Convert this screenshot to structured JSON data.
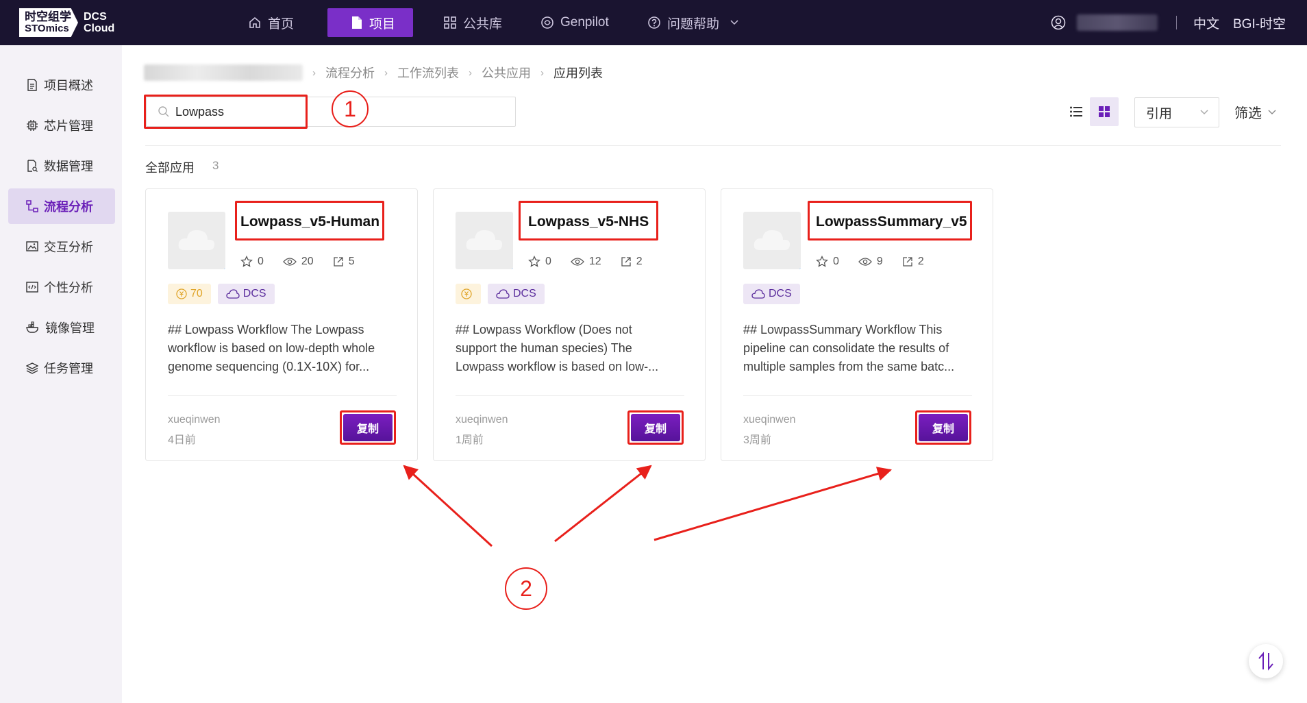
{
  "logo": {
    "line1": "时空组学",
    "line2": "STOmics",
    "product1": "DCS",
    "product2": "Cloud"
  },
  "nav": [
    {
      "label": "首页",
      "icon": "home-icon"
    },
    {
      "label": "项目",
      "icon": "file-icon"
    },
    {
      "label": "公共库",
      "icon": "grid-icon"
    },
    {
      "label": "Genpilot",
      "icon": "genpilot-icon"
    },
    {
      "label": "问题帮助",
      "icon": "help-icon"
    }
  ],
  "header_right": {
    "language": "中文",
    "org": "BGI-时空"
  },
  "sidebar": [
    {
      "label": "项目概述",
      "icon": "overview-icon"
    },
    {
      "label": "芯片管理",
      "icon": "chip-icon"
    },
    {
      "label": "数据管理",
      "icon": "data-icon"
    },
    {
      "label": "流程分析",
      "icon": "workflow-icon",
      "active": true
    },
    {
      "label": "交互分析",
      "icon": "image-icon"
    },
    {
      "label": "个性分析",
      "icon": "code-icon"
    },
    {
      "label": "镜像管理",
      "icon": "docker-icon"
    },
    {
      "label": "任务管理",
      "icon": "layers-icon"
    }
  ],
  "breadcrumb": [
    "流程分析",
    "工作流列表",
    "公共应用",
    "应用列表"
  ],
  "search": {
    "value": "Lowpass"
  },
  "toolbar": {
    "cite_label": "引用",
    "filter_label": "筛选"
  },
  "list_header": {
    "label": "全部应用",
    "count": "3"
  },
  "cards": [
    {
      "title": "Lowpass_v5-Human",
      "stars": "0",
      "views": "20",
      "cites": "5",
      "price": "70",
      "dcs": "DCS",
      "desc": [
        "## Lowpass Workflow The Lowpass",
        "workflow is based on low-depth whole",
        "genome sequencing (0.1X-10X) for..."
      ],
      "author": "xueqinwen",
      "time": "4日前",
      "copy": "复制"
    },
    {
      "title": "Lowpass_v5-NHS",
      "stars": "0",
      "views": "12",
      "cites": "2",
      "price": "",
      "dcs": "DCS",
      "desc": [
        "## Lowpass Workflow (Does not",
        "support the human species) The",
        "Lowpass workflow is based on low-..."
      ],
      "author": "xueqinwen",
      "time": "1周前",
      "copy": "复制"
    },
    {
      "title": "LowpassSummary_v5",
      "stars": "0",
      "views": "9",
      "cites": "2",
      "dcs": "DCS",
      "desc": [
        "## LowpassSummary Workflow This",
        "pipeline can consolidate the results of",
        "multiple samples from the same batc..."
      ],
      "author": "xueqinwen",
      "time": "3周前",
      "copy": "复制"
    }
  ],
  "annotations": {
    "step1": "1",
    "step2": "2"
  },
  "colors": {
    "brand_purple": "#6a1fb8",
    "topbar": "#1a1430",
    "annotation_red": "#e8201b",
    "badge_blue": "#2e8df0"
  }
}
